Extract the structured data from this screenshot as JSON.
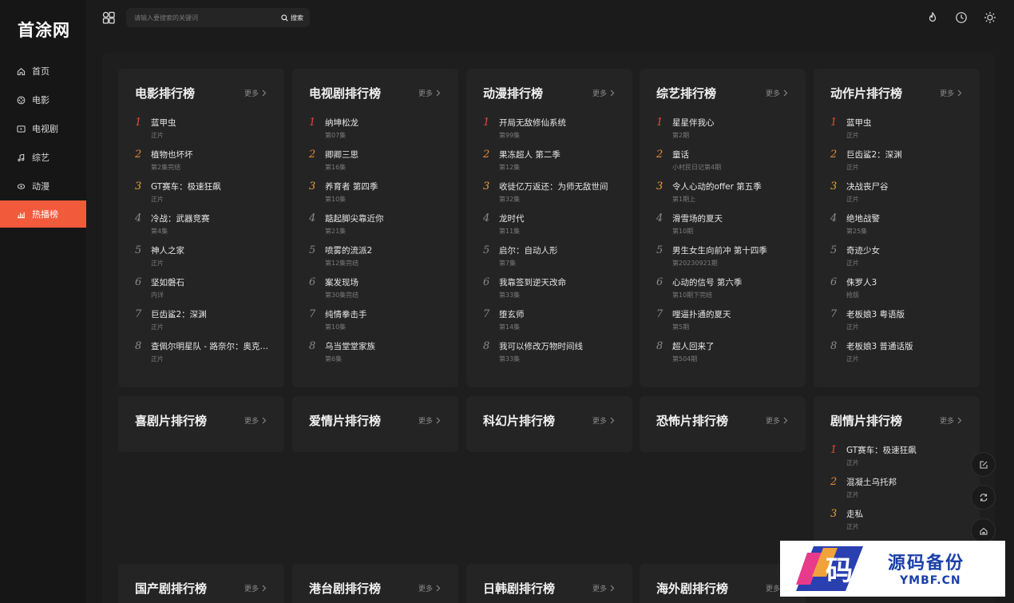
{
  "site": {
    "logo": "首涂网"
  },
  "nav": [
    {
      "label": "首页",
      "icon": "home-icon"
    },
    {
      "label": "电影",
      "icon": "film-reel-icon"
    },
    {
      "label": "电视剧",
      "icon": "tv-icon"
    },
    {
      "label": "综艺",
      "icon": "music-note-icon"
    },
    {
      "label": "动漫",
      "icon": "anime-icon"
    },
    {
      "label": "热播榜",
      "icon": "chart-bars-icon",
      "active": true
    }
  ],
  "search": {
    "placeholder": "请输入要搜索的关键词",
    "button": "搜索"
  },
  "more_label": "更多",
  "cards": [
    {
      "title": "电影排行榜",
      "items": [
        {
          "name": "蓝甲虫",
          "sub": "正片"
        },
        {
          "name": "植物也坏坏",
          "sub": "第2集完结"
        },
        {
          "name": "GT赛车：极速狂飙",
          "sub": "正片"
        },
        {
          "name": "冷战：武器竞赛",
          "sub": "第4集"
        },
        {
          "name": "神人之家",
          "sub": "正片"
        },
        {
          "name": "坚如磐石",
          "sub": "内详"
        },
        {
          "name": "巨齿鲨2：深渊",
          "sub": "正片"
        },
        {
          "name": "查佩尔明星队 - 路奈尔：奥克…",
          "sub": "正片"
        }
      ]
    },
    {
      "title": "电视剧排行榜",
      "items": [
        {
          "name": "纳坤松龙",
          "sub": "第07集"
        },
        {
          "name": "卿卿三思",
          "sub": "第16集"
        },
        {
          "name": "养育者 第四季",
          "sub": "第10集"
        },
        {
          "name": "踮起脚尖靠近你",
          "sub": "第21集"
        },
        {
          "name": "喷雾的流派2",
          "sub": "第12集完结"
        },
        {
          "name": "案发现场",
          "sub": "第30集完结"
        },
        {
          "name": "纯情拳击手",
          "sub": "第10集"
        },
        {
          "name": "乌当堂堂家族",
          "sub": "第6集"
        }
      ]
    },
    {
      "title": "动漫排行榜",
      "items": [
        {
          "name": "开局无敌修仙系统",
          "sub": "第99集"
        },
        {
          "name": "果冻超人 第二季",
          "sub": "第12集"
        },
        {
          "name": "收徒亿万返还：为师无敌世间",
          "sub": "第32集"
        },
        {
          "name": "龙时代",
          "sub": "第11集"
        },
        {
          "name": "启尔：自动人形",
          "sub": "第7集"
        },
        {
          "name": "我靠签到逆天改命",
          "sub": "第33集"
        },
        {
          "name": "堕玄师",
          "sub": "第14集"
        },
        {
          "name": "我可以修改万物时间线",
          "sub": "第33集"
        }
      ]
    },
    {
      "title": "综艺排行榜",
      "items": [
        {
          "name": "星星伴我心",
          "sub": "第2期"
        },
        {
          "name": "童话",
          "sub": "小村民日记第4期"
        },
        {
          "name": "令人心动的offer 第五季",
          "sub": "第1期上"
        },
        {
          "name": "滑雪场的夏天",
          "sub": "第10期"
        },
        {
          "name": "男生女生向前冲 第十四季",
          "sub": "第20230921期"
        },
        {
          "name": "心动的信号 第六季",
          "sub": "第10期下完结"
        },
        {
          "name": "哩逼扑通的夏天",
          "sub": "第5期"
        },
        {
          "name": "超人回来了",
          "sub": "第504期"
        }
      ]
    },
    {
      "title": "动作片排行榜",
      "items": [
        {
          "name": "蓝甲虫",
          "sub": "正片"
        },
        {
          "name": "巨齿鲨2：深渊",
          "sub": "正片"
        },
        {
          "name": "决战丧尸谷",
          "sub": "正片"
        },
        {
          "name": "绝地战警",
          "sub": "第25集"
        },
        {
          "name": "奇迹少女",
          "sub": "正片"
        },
        {
          "name": "侏罗人3",
          "sub": "抢版"
        },
        {
          "name": "老板娘3 粤语版",
          "sub": "正片"
        },
        {
          "name": "老板娘3 普通话版",
          "sub": "正片"
        }
      ]
    },
    {
      "title": "喜剧片排行榜",
      "items": []
    },
    {
      "title": "爱情片排行榜",
      "items": []
    },
    {
      "title": "科幻片排行榜",
      "items": []
    },
    {
      "title": "恐怖片排行榜",
      "items": []
    },
    {
      "title": "剧情片排行榜",
      "items": [
        {
          "name": "GT赛车：极速狂飙",
          "sub": "正片"
        },
        {
          "name": "混凝土乌托邦",
          "sub": "正片"
        },
        {
          "name": "走私",
          "sub": "正片"
        }
      ]
    },
    {
      "title": "国产剧排行榜",
      "items": []
    },
    {
      "title": "港台剧排行榜",
      "items": []
    },
    {
      "title": "日韩剧排行榜",
      "items": []
    },
    {
      "title": "海外剧排行榜",
      "items": []
    }
  ],
  "watermark": {
    "text": "源码备份",
    "domain": "YMBF.CN",
    "logo_char": "码"
  }
}
